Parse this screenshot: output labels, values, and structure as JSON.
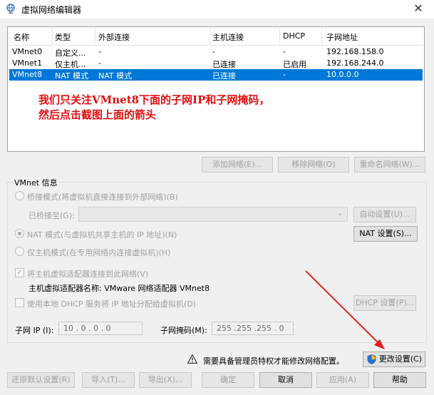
{
  "window": {
    "title": "虚拟网络编辑器",
    "close": "✕"
  },
  "table": {
    "headers": [
      "名称",
      "类型",
      "外部连接",
      "主机连接",
      "DHCP",
      "子网地址"
    ],
    "rows": [
      [
        "VMnet0",
        "自定义...",
        "-",
        "-",
        "-",
        "192.168.158.0"
      ],
      [
        "VMnet1",
        "仅主机...",
        "-",
        "已连接",
        "已启用",
        "192.168.244.0"
      ],
      [
        "VMnet8",
        "NAT 模式",
        "NAT 模式",
        "已连接",
        "-",
        "10.0.0.0"
      ]
    ],
    "selected_index": 2
  },
  "annotation": {
    "line1": "我们只关注VMnet8下面的子网IP和子网掩码，",
    "line2": "然后点击截图上面的箭头"
  },
  "network_buttons": {
    "add": "添加网络(E)...",
    "remove": "移除网络(O)",
    "rename": "重命名网络(W)..."
  },
  "vmnet_info": {
    "title": "VMnet 信息",
    "bridge_mode": "桥接模式(将虚拟机直接连接到外部网络)(B)",
    "bridged_to_label": "已桥接至(G):",
    "auto_settings": "自动设置(U)...",
    "nat_mode": "NAT 模式(与虚拟机共享主机的 IP 地址)(N)",
    "nat_settings": "NAT 设置(S)...",
    "host_only_mode": "仅主机模式(在专用网络内连接虚拟机)(H)",
    "connect_adapter": "将主机虚拟适配器连接到此网络(V)",
    "adapter_name": "主机虚拟适配器名称: VMware 网络适配器 VMnet8",
    "use_dhcp": "使用本地 DHCP 服务将 IP 地址分配给虚拟机(D)",
    "dhcp_settings": "DHCP 设置(P)...",
    "subnet_ip_label": "子网 IP (I):",
    "subnet_ip": "10 .  0 .  0 .  0",
    "subnet_mask_label": "子网掩码(M):",
    "subnet_mask": "255 .255 .255 .  0"
  },
  "admin_notice": "需要具备管理员特权才能修改网络配置。",
  "change_settings": "更改设置(C)",
  "footer": {
    "restore": "还原默认设置(R)",
    "import": "导入(T)...",
    "export": "导出(X)...",
    "ok": "确定",
    "cancel": "取消",
    "apply": "应用(A)",
    "help": "帮助"
  },
  "colors": {
    "selection": "#0078d7",
    "annotation": "#e01010",
    "arrow": "#e02020"
  }
}
